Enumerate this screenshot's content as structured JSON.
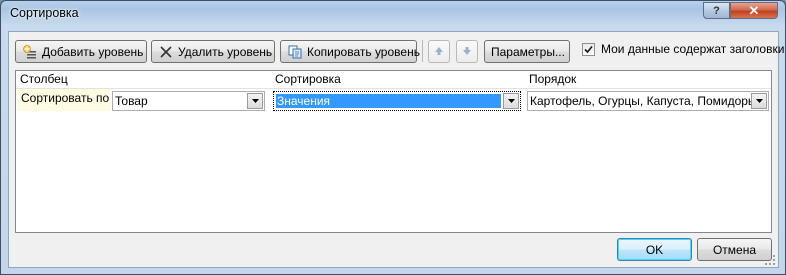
{
  "window": {
    "title": "Сортировка",
    "help": "?",
    "close": "✕"
  },
  "toolbar": {
    "add_level": "Добавить уровень",
    "delete_level": "Удалить уровень",
    "copy_level": "Копировать уровень",
    "options": "Параметры...",
    "headers_checkbox_label": "Мои данные содержат заголовки",
    "headers_checked": true
  },
  "grid": {
    "columns": [
      "Столбец",
      "Сортировка",
      "Порядок"
    ],
    "row_label": "Сортировать по",
    "rows": [
      {
        "column": "Товар",
        "sort_on": "Значения",
        "order": "Картофель, Огурцы, Капуста, Помидоры"
      }
    ]
  },
  "footer": {
    "ok": "OK",
    "cancel": "Отмена"
  },
  "colors": {
    "title_bg": "#b9d1ea",
    "close": "#c3401f",
    "selection": "#3399ff"
  }
}
